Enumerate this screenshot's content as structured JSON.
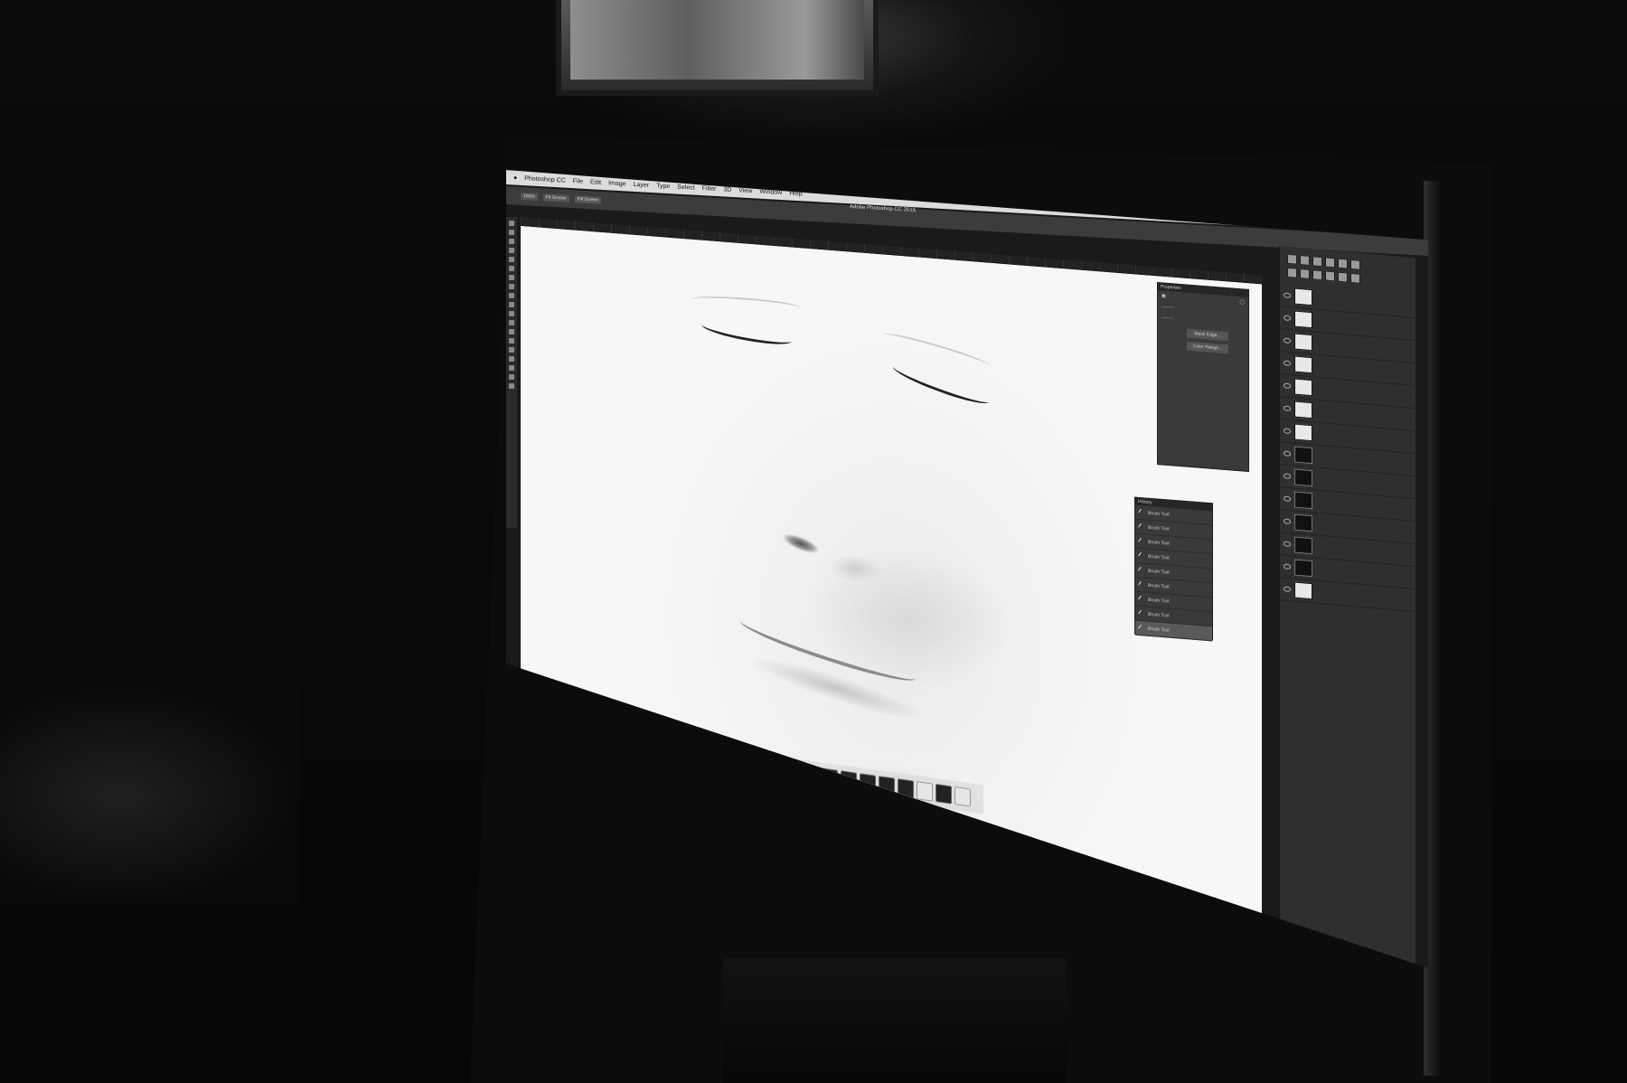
{
  "menubar": {
    "app_menu": "Photoshop CC",
    "items": [
      "File",
      "Edit",
      "Image",
      "Layer",
      "Type",
      "Select",
      "Filter",
      "3D",
      "View",
      "Window",
      "Help"
    ]
  },
  "options_bar": {
    "buttons": [
      "100%",
      "Fit Screen",
      "Fill Screen"
    ]
  },
  "window_title": "Adobe Photoshop CC 2015",
  "panels": {
    "properties": {
      "title": "Properties",
      "buttons": [
        "Mask Edge...",
        "Color Range..."
      ]
    },
    "history": {
      "title": "History",
      "items": [
        "Brush Tool",
        "Brush Tool",
        "Brush Tool",
        "Brush Tool",
        "Brush Tool",
        "Brush Tool",
        "Brush Tool",
        "Brush Tool",
        "Brush Tool"
      ],
      "selected_index": 8
    }
  },
  "layers": {
    "rows": [
      {
        "thumb": "light"
      },
      {
        "thumb": "light"
      },
      {
        "thumb": "light"
      },
      {
        "thumb": "light"
      },
      {
        "thumb": "light"
      },
      {
        "thumb": "light"
      },
      {
        "thumb": "light"
      },
      {
        "thumb": "dark"
      },
      {
        "thumb": "dark"
      },
      {
        "thumb": "dark"
      },
      {
        "thumb": "dark"
      },
      {
        "thumb": "dark"
      },
      {
        "thumb": "dark"
      },
      {
        "thumb": "light"
      }
    ]
  },
  "colors": {
    "canvas": "#f4f4f4",
    "ui_dark": "#3a3a3a",
    "room": "#050505"
  }
}
